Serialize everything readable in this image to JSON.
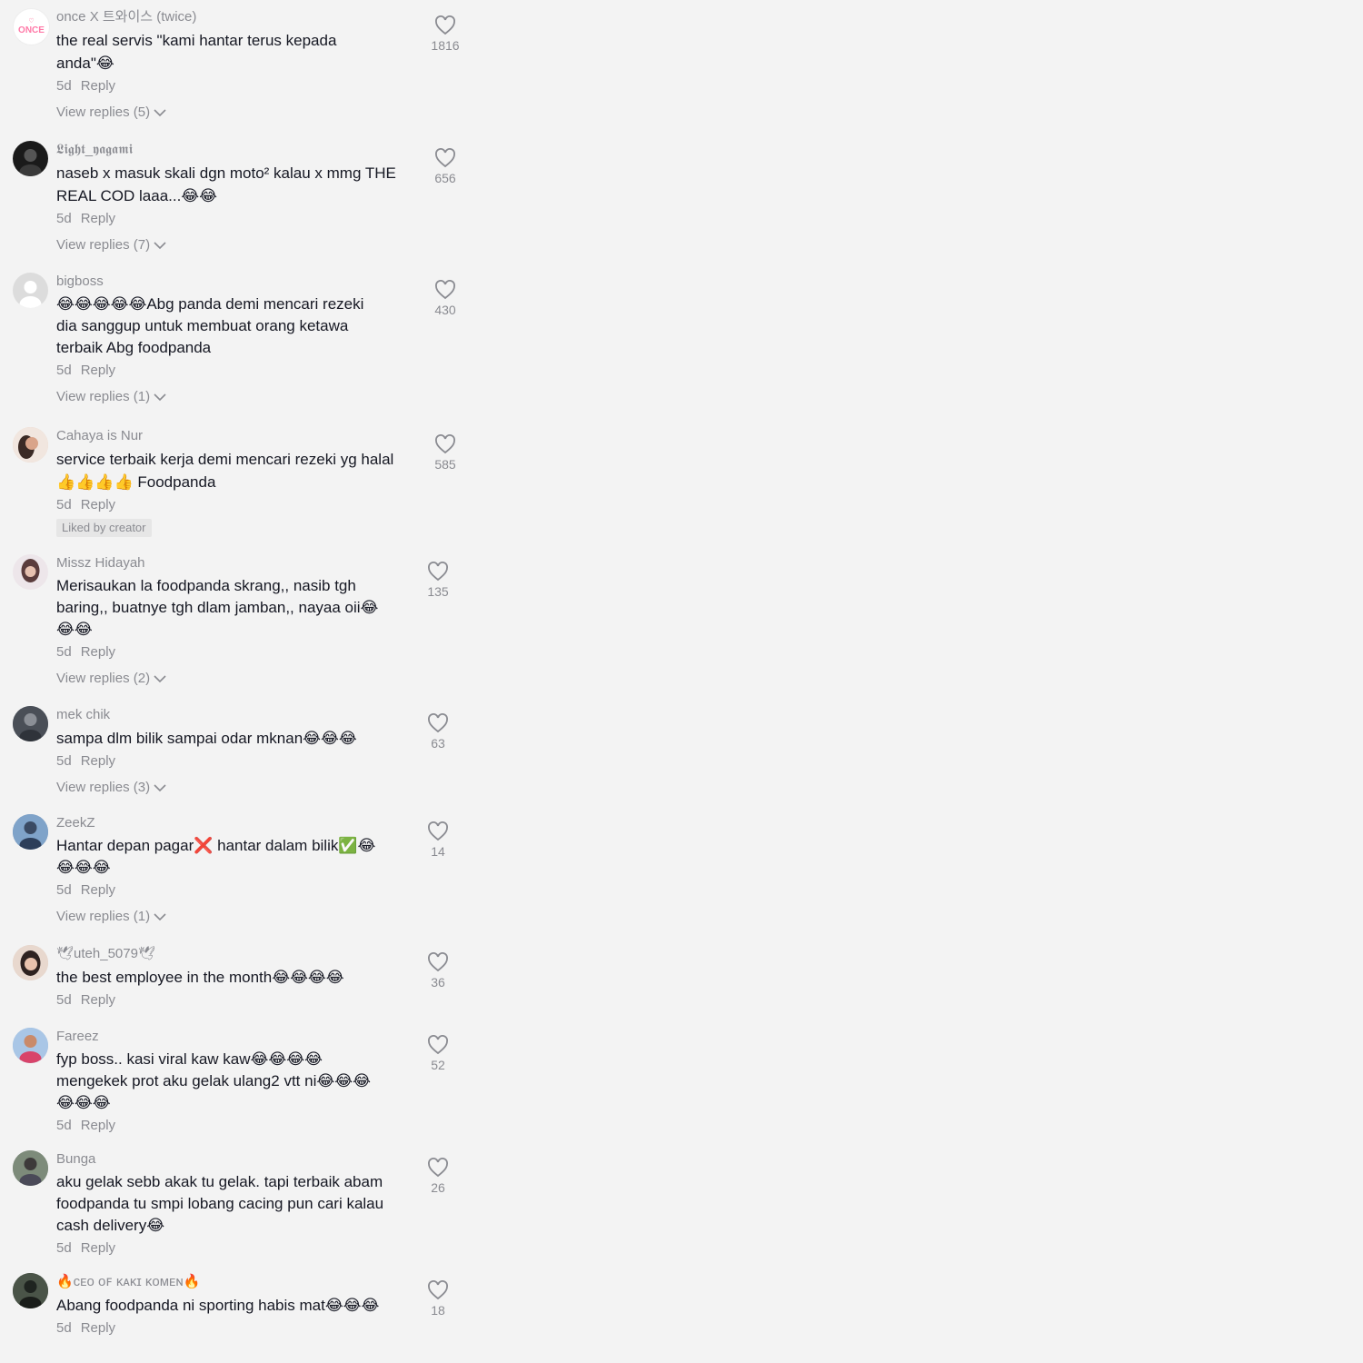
{
  "comments": [
    {
      "username": "once X 트와이스 (twice)",
      "text": "the real servis \"kami hantar terus kepada\nanda\"😂",
      "time": "5d",
      "reply": "Reply",
      "likes": "1816",
      "view_replies": "View replies (5)",
      "liked_by_creator": "",
      "avatar": "once-logo-icon"
    },
    {
      "username": "𝕷𝖎𝖌𝖍𝖙_𝖞𝖆𝖌𝖆𝖒𝖎",
      "text": "naseb x masuk skali dgn moto² kalau x mmg THE\nREAL COD laaa...😂😂",
      "time": "5d",
      "reply": "Reply",
      "likes": "656",
      "view_replies": "View replies (7)",
      "liked_by_creator": "",
      "avatar": "profile-photo"
    },
    {
      "username": "bigboss",
      "text": "😂😂😂😂😂Abg panda demi mencari rezeki\ndia sanggup untuk membuat orang ketawa\nterbaik Abg foodpanda",
      "time": "5d",
      "reply": "Reply",
      "likes": "430",
      "view_replies": "View replies (1)",
      "liked_by_creator": "",
      "avatar": "default-avatar-icon"
    },
    {
      "username": "Cahaya is Nur",
      "text": "service terbaik kerja demi mencari rezeki yg halal\n👍👍👍👍 Foodpanda",
      "time": "5d",
      "reply": "Reply",
      "likes": "585",
      "view_replies": "",
      "liked_by_creator": "Liked by creator",
      "avatar": "profile-photo"
    },
    {
      "username": "Missz Hidayah",
      "text": "Merisaukan la foodpanda skrang,, nasib tgh\nbaring,, buatnye tgh dlam jamban,, nayaa oii😂\n😂😂",
      "time": "5d",
      "reply": "Reply",
      "likes": "135",
      "view_replies": "View replies (2)",
      "liked_by_creator": "",
      "avatar": "profile-photo"
    },
    {
      "username": "mek chik",
      "text": "sampa dlm bilik sampai odar mknan😂😂😂",
      "time": "5d",
      "reply": "Reply",
      "likes": "63",
      "view_replies": "View replies (3)",
      "liked_by_creator": "",
      "avatar": "profile-photo"
    },
    {
      "username": "ZeekZ",
      "text": "Hantar depan pagar❌ hantar dalam bilik✅😂\n😂😂😂",
      "time": "5d",
      "reply": "Reply",
      "likes": "14",
      "view_replies": "View replies (1)",
      "liked_by_creator": "",
      "avatar": "profile-photo"
    },
    {
      "username": "🕊uteh_5079🕊",
      "text": "the best employee in the month😂😂😂😂",
      "time": "5d",
      "reply": "Reply",
      "likes": "36",
      "view_replies": "",
      "liked_by_creator": "",
      "avatar": "profile-photo"
    },
    {
      "username": "Fareez",
      "text": "fyp boss.. kasi viral kaw kaw😂😂😂😂\nmengekek prot aku gelak ulang2 vtt ni😂😂😂\n😂😂😂",
      "time": "5d",
      "reply": "Reply",
      "likes": "52",
      "view_replies": "",
      "liked_by_creator": "",
      "avatar": "profile-photo"
    },
    {
      "username": "Bunga",
      "text": "aku gelak sebb akak tu gelak. tapi terbaik abam\nfoodpanda tu smpi lobang cacing pun cari kalau\ncash delivery😂",
      "time": "5d",
      "reply": "Reply",
      "likes": "26",
      "view_replies": "",
      "liked_by_creator": "",
      "avatar": "profile-photo"
    },
    {
      "username": "🔥ᴄᴇᴏ ᴏꜰ ᴋᴀᴋɪ ᴋᴏᴍᴇɴ🔥",
      "text": "Abang foodpanda ni sporting habis mat😂😂😂",
      "time": "5d",
      "reply": "Reply",
      "likes": "18",
      "view_replies": "",
      "liked_by_creator": "",
      "avatar": "profile-photo"
    }
  ]
}
